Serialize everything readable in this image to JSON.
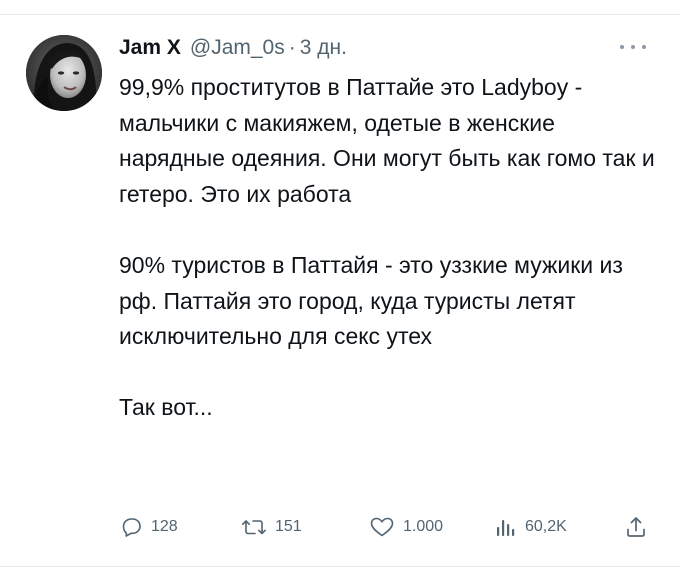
{
  "tweet": {
    "author_name": "Jam X",
    "handle": "@Jam_0s",
    "separator": "·",
    "time": "3 дн.",
    "paragraphs": [
      "99,9% проститутов в Паттайе это Ladyboy - мальчики с макияжем, одетые в женские нарядные одеяния. Они могут быть как гомо так и гетеро. Это их работа",
      "90% туристов в Паттайя - это уззкие мужики из рф. Паттайя это город, куда туристы летят исключительно для секс утех",
      "Так вот..."
    ]
  },
  "actions": {
    "replies": "128",
    "retweets": "151",
    "likes": "1.000",
    "views": "60,2K"
  },
  "icons": {
    "more": "more-horizontal-icon",
    "reply": "reply-icon",
    "retweet": "retweet-icon",
    "like": "heart-icon",
    "views": "views-chart-icon",
    "share": "share-icon"
  },
  "colors": {
    "text": "#0f1419",
    "secondary": "#536471",
    "divider": "#e6e9ec"
  }
}
